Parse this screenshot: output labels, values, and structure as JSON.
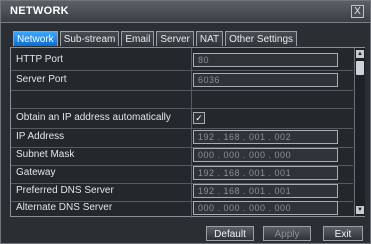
{
  "window": {
    "title": "NETWORK",
    "close_label": "X"
  },
  "tabs": [
    {
      "label": "Network",
      "active": true
    },
    {
      "label": "Sub-stream"
    },
    {
      "label": "Email"
    },
    {
      "label": "Server"
    },
    {
      "label": "NAT"
    },
    {
      "label": "Other Settings"
    }
  ],
  "settings": {
    "http_port": {
      "label": "HTTP Port",
      "value": "80"
    },
    "server_port": {
      "label": "Server Port",
      "value": "6036"
    },
    "dhcp": {
      "label": "Obtain an IP address automatically",
      "checked_mark": "✓"
    },
    "ip_address": {
      "label": "IP Address",
      "value": "192 . 168 . 001 . 002"
    },
    "subnet_mask": {
      "label": "Subnet Mask",
      "value": "000 . 000 . 000 . 000"
    },
    "gateway": {
      "label": "Gateway",
      "value": "192 . 168 . 001 . 001"
    },
    "preferred_dns": {
      "label": "Preferred DNS Server",
      "value": "192 . 168 . 001 . 001"
    },
    "alternate_dns": {
      "label": "Alternate DNS Server",
      "value": "000 . 000 . 000 . 000"
    }
  },
  "buttons": {
    "default": "Default",
    "apply": "Apply",
    "exit": "Exit"
  },
  "colors": {
    "active_tab": "#1a8cf0",
    "background": "#2b2f33"
  }
}
